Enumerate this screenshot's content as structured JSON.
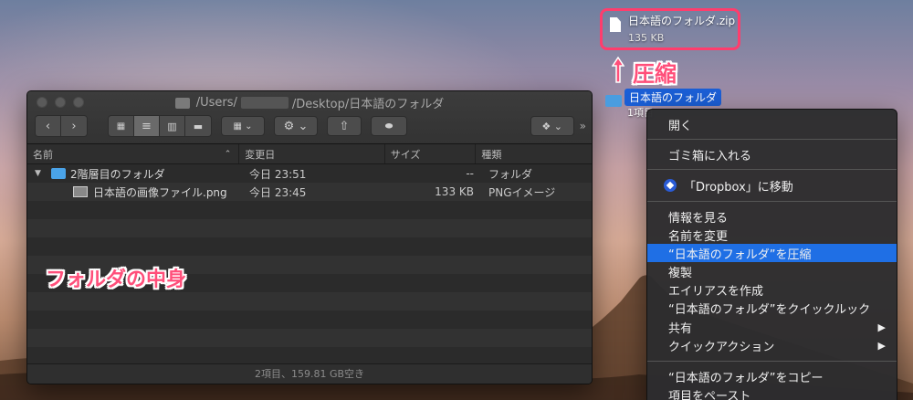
{
  "window": {
    "title_prefix": "/Users/",
    "title_suffix": "/Desktop/日本語のフォルダ"
  },
  "columns": {
    "name": "名前",
    "date": "変更日",
    "size": "サイズ",
    "kind": "種類"
  },
  "rows": [
    {
      "name": "2階層目のフォルダ",
      "date": "今日 23:51",
      "size": "--",
      "kind": "フォルダ"
    },
    {
      "name": "日本語の画像ファイル.png",
      "date": "今日 23:45",
      "size": "133 KB",
      "kind": "PNGイメージ"
    }
  ],
  "status": "2項目、159.81 GB空き",
  "annotations": {
    "folder_contents": "フォルダの中身",
    "compress": "圧縮"
  },
  "desktop": {
    "zip_name": "日本語のフォルダ.zip",
    "zip_size": "135 KB",
    "folder_name": "日本語のフォルダ",
    "folder_sub": "1項目"
  },
  "menu": {
    "open": "開く",
    "trash": "ゴミ箱に入れる",
    "dropbox": "「Dropbox」に移動",
    "info": "情報を見る",
    "rename": "名前を変更",
    "compress": "“日本語のフォルダ”を圧縮",
    "duplicate": "複製",
    "alias": "エイリアスを作成",
    "quicklook": "“日本語のフォルダ”をクイックルック",
    "share": "共有",
    "quick_actions": "クイックアクション",
    "copy": "“日本語のフォルダ”をコピー",
    "paste": "項目をペースト"
  },
  "colors": {
    "accent": "#ff4f7a",
    "highlight": "#1f6fe5"
  }
}
